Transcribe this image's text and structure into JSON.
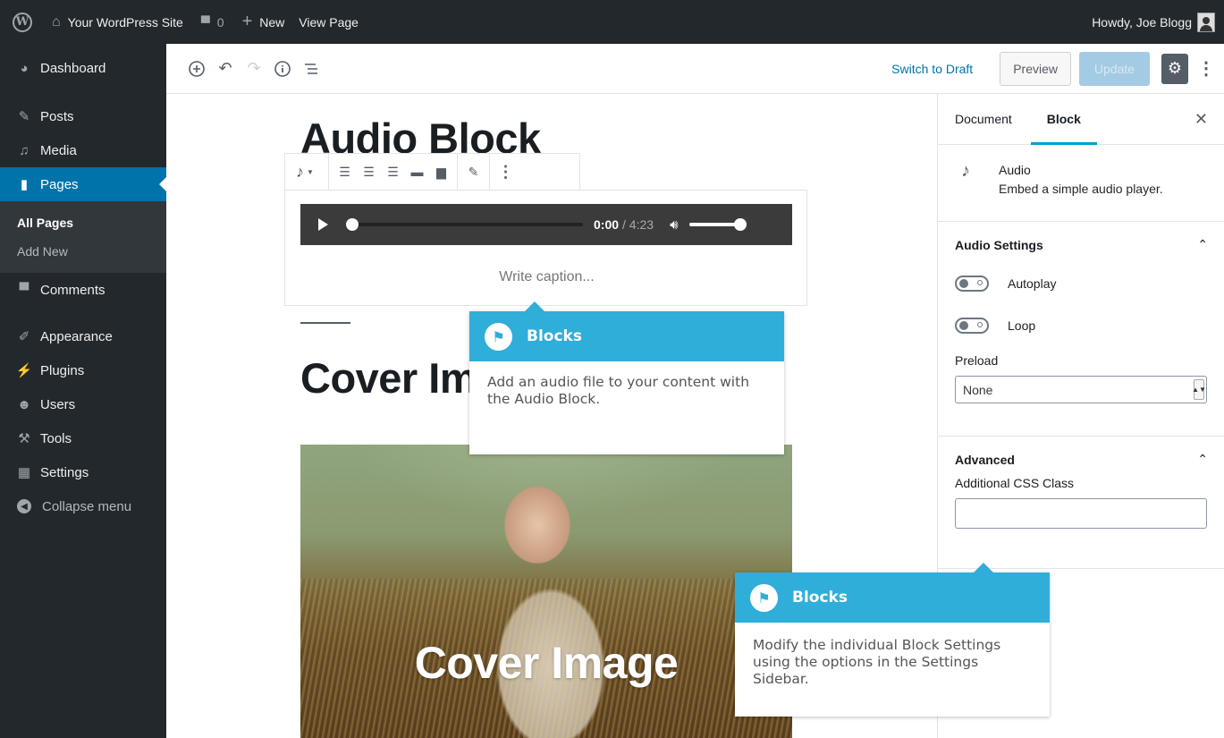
{
  "admin_bar": {
    "site_name": "Your WordPress Site",
    "comments_count": "0",
    "new_label": "New",
    "view_page_label": "View Page",
    "greeting": "Howdy, Joe Blogg"
  },
  "admin_menu": {
    "items": [
      {
        "label": "Dashboard",
        "icon": "dashboard-icon"
      },
      {
        "label": "Posts",
        "icon": "pin-icon"
      },
      {
        "label": "Media",
        "icon": "media-icon"
      },
      {
        "label": "Pages",
        "icon": "pages-icon"
      },
      {
        "label": "Comments",
        "icon": "comment-icon"
      },
      {
        "label": "Appearance",
        "icon": "brush-icon"
      },
      {
        "label": "Plugins",
        "icon": "plug-icon"
      },
      {
        "label": "Users",
        "icon": "users-icon"
      },
      {
        "label": "Tools",
        "icon": "wrench-icon"
      },
      {
        "label": "Settings",
        "icon": "sliders-icon"
      }
    ],
    "submenu": [
      "All Pages",
      "Add New"
    ],
    "collapse_label": "Collapse menu",
    "accent": "#0073aa"
  },
  "editor_header": {
    "switch_to_draft": "Switch to Draft",
    "preview": "Preview",
    "update": "Update"
  },
  "content": {
    "title": "Audio Block",
    "audio": {
      "current_time": "0:00",
      "duration": "/ 4:23",
      "progress": 0,
      "volume": 1
    },
    "caption_placeholder": "Write caption...",
    "heading": "Cover Image",
    "cover_text": "Cover Image"
  },
  "settings_sidebar": {
    "tab_document": "Document",
    "tab_block": "Block",
    "block_name": "Audio",
    "block_description": "Embed a simple audio player.",
    "audio_settings_title": "Audio Settings",
    "autoplay_label": "Autoplay",
    "loop_label": "Loop",
    "preload_label": "Preload",
    "preload_value": "None",
    "advanced_title": "Advanced",
    "css_class_label": "Additional CSS Class",
    "css_class_value": ""
  },
  "popups": [
    {
      "title": "Blocks",
      "body": "Add an audio file to your content with the Audio Block."
    },
    {
      "title": "Blocks",
      "body": "Modify the individual Block Settings using the options in the Settings Sidebar."
    }
  ],
  "colors": {
    "popup_header": "#2faed9",
    "admin_dark": "#23282d",
    "link": "#0073aa"
  }
}
